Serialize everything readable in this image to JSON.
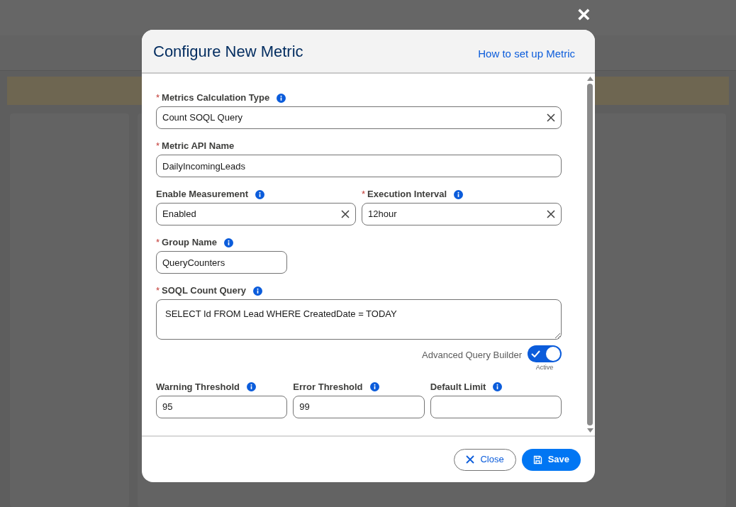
{
  "modal": {
    "title": "Configure New Metric",
    "help_link": "How to set up Metric",
    "close_icon": "×"
  },
  "rows": [
    [
      {
        "kind": "combobox",
        "label": "Metrics Calculation Type",
        "required_mark": "*",
        "info": true,
        "value": "Count SOQL Query"
      }
    ],
    [
      {
        "kind": "text",
        "label": "Metric API Name",
        "required_mark": "*",
        "info": false,
        "value": "DailyIncomingLeads"
      }
    ],
    [
      {
        "kind": "combobox",
        "label": "Enable Measurement",
        "info": true,
        "value": "Enabled"
      },
      {
        "kind": "combobox",
        "label": "Execution Interval",
        "required_mark": "*",
        "info": true,
        "value": "12hour"
      }
    ],
    [
      {
        "kind": "text",
        "label": "Group Name",
        "required_mark": "*",
        "info": true,
        "value": "QueryCounters"
      }
    ],
    [
      {
        "kind": "textarea",
        "label": "SOQL Count Query",
        "required_mark": "*",
        "info": true,
        "value": "SELECT Id FROM Lead WHERE CreatedDate = TODAY"
      }
    ],
    [
      {
        "kind": "toggle",
        "label": "Advanced Query Builder",
        "on": true,
        "status": "Active"
      }
    ],
    [
      {
        "kind": "text",
        "label": "Warning Threshold",
        "info": true,
        "value": "95"
      },
      {
        "kind": "text",
        "label": "Error Threshold",
        "info": true,
        "value": "99"
      },
      {
        "kind": "text",
        "label": "Default Limit",
        "info": true
      }
    ]
  ],
  "footer": {
    "buttons": [
      {
        "kind": "close",
        "label": "Close"
      },
      {
        "kind": "save",
        "label": "Save"
      }
    ]
  }
}
